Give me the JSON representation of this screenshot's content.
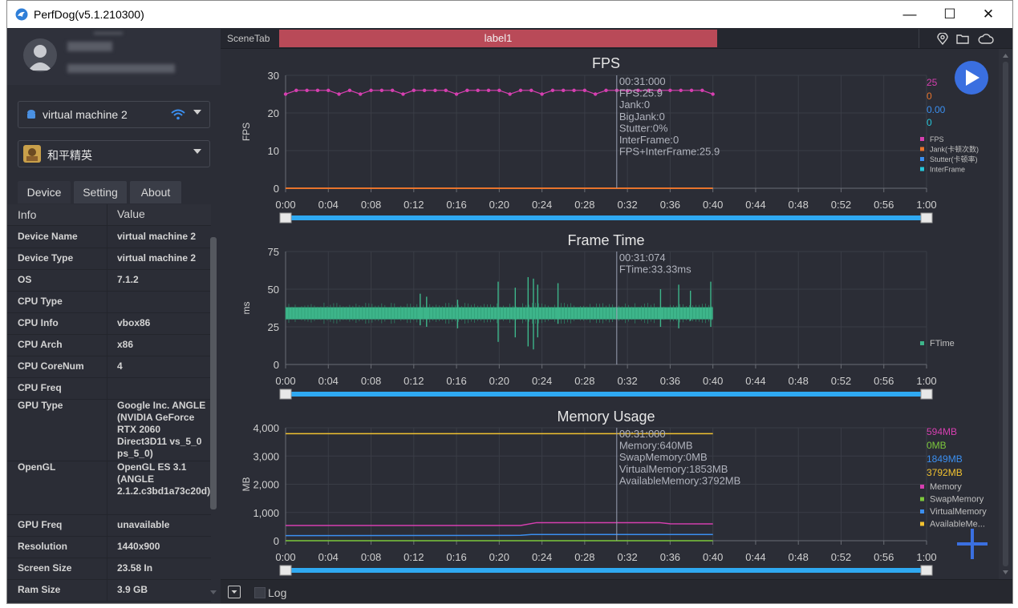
{
  "window": {
    "title": "PerfDog(v5.1.210300)",
    "minimize": "—",
    "maximize": "☐",
    "close": "✕"
  },
  "sidebar": {
    "device_select": "virtual machine 2",
    "app_select": "和平精英",
    "tabs": [
      {
        "label": "Device"
      },
      {
        "label": "Setting"
      },
      {
        "label": "About"
      }
    ],
    "table_header": {
      "key": "Info",
      "value": "Value"
    },
    "rows": [
      {
        "key": "Device Name",
        "value": "virtual machine 2"
      },
      {
        "key": "Device Type",
        "value": "virtual machine 2"
      },
      {
        "key": "OS",
        "value": "7.1.2"
      },
      {
        "key": "CPU Type",
        "value": ""
      },
      {
        "key": "CPU Info",
        "value": "vbox86"
      },
      {
        "key": "CPU Arch",
        "value": "x86"
      },
      {
        "key": "CPU CoreNum",
        "value": "4"
      },
      {
        "key": "CPU Freq",
        "value": ""
      },
      {
        "key": "GPU Type",
        "value": "Google Inc. ANGLE (NVIDIA GeForce RTX 2060 Direct3D11 vs_5_0 ps_5_0)"
      },
      {
        "key": "OpenGL",
        "value": "OpenGL ES 3.1 (ANGLE 2.1.2.c3bd1a73c20d)"
      },
      {
        "key": "GPU Freq",
        "value": "unavailable"
      },
      {
        "key": "Resolution",
        "value": "1440x900"
      },
      {
        "key": "Screen Size",
        "value": "23.58 In"
      },
      {
        "key": "Ram Size",
        "value": "3.9 GB"
      }
    ]
  },
  "scenebar": {
    "scene_tab": "SceneTab",
    "label": "label1"
  },
  "bottombar": {
    "log": "Log"
  },
  "colors": {
    "fps": "#d63fb0",
    "jank": "#e8742c",
    "stutter": "#3b8ff0",
    "interframe": "#26c6da",
    "ftime": "#3db58a",
    "memory": "#d63fb0",
    "swap": "#7cc83c",
    "virtual": "#3b8ff0",
    "available": "#f2c230",
    "accent_bar": "#2fa9f2",
    "play": "#3a6fe0"
  },
  "chart_data": [
    {
      "type": "line",
      "title": "FPS",
      "ylabel": "FPS",
      "xlabel": "",
      "x_ticks": [
        "0:00",
        "0:04",
        "0:08",
        "0:12",
        "0:16",
        "0:20",
        "0:24",
        "0:28",
        "0:32",
        "0:36",
        "0:40",
        "0:44",
        "0:48",
        "0:52",
        "0:56",
        "1:00"
      ],
      "xlim": [
        0,
        60
      ],
      "ylim": [
        0,
        30
      ],
      "y_ticks": [
        "0",
        "10",
        "20",
        "30"
      ],
      "cursor_x": 31,
      "series": [
        {
          "name": "FPS",
          "x": [
            0,
            1,
            2,
            3,
            4,
            5,
            6,
            7,
            8,
            9,
            10,
            11,
            12,
            13,
            14,
            15,
            16,
            17,
            18,
            19,
            20,
            21,
            22,
            23,
            24,
            25,
            26,
            27,
            28,
            29,
            30,
            31,
            32,
            33,
            34,
            35,
            36,
            37,
            38,
            39,
            40
          ],
          "values": [
            25,
            26,
            26,
            26,
            26,
            25,
            26,
            25,
            26,
            26,
            26,
            25,
            26,
            26,
            26,
            26,
            25,
            26,
            26,
            26,
            26,
            25,
            26,
            26,
            25,
            26,
            26,
            26,
            26,
            25,
            26,
            26,
            25.9,
            26,
            26,
            26,
            26,
            26,
            26,
            26,
            25
          ]
        },
        {
          "name": "Jank(卡顿次数)",
          "x": [
            0,
            40
          ],
          "values": [
            0,
            0
          ]
        },
        {
          "name": "Stutter(卡顿率)",
          "x": [
            0,
            40
          ],
          "values": [
            0,
            0
          ]
        },
        {
          "name": "InterFrame",
          "x": [
            0,
            40
          ],
          "values": [
            0,
            0
          ]
        }
      ],
      "legend_values": [
        "25",
        "0",
        "0.00",
        "0"
      ],
      "tooltip": [
        "00:31:000",
        "FPS:25.9",
        "Jank:0",
        "BigJank:0",
        "Stutter:0%",
        "InterFrame:0",
        "FPS+InterFrame:25.9"
      ]
    },
    {
      "type": "bar",
      "title": "Frame Time",
      "ylabel": "ms",
      "xlabel": "",
      "x_ticks": [
        "0:00",
        "0:04",
        "0:08",
        "0:12",
        "0:16",
        "0:20",
        "0:24",
        "0:28",
        "0:32",
        "0:36",
        "0:40",
        "0:44",
        "0:48",
        "0:52",
        "0:56",
        "1:00"
      ],
      "xlim": [
        0,
        60
      ],
      "ylim": [
        0,
        75
      ],
      "y_ticks": [
        "0",
        "25",
        "50",
        "75"
      ],
      "cursor_x": 31,
      "series": [
        {
          "name": "FTime",
          "band": [
            30,
            38
          ],
          "spikes": [
            {
              "x": 12.6,
              "low": 26,
              "high": 47
            },
            {
              "x": 13.2,
              "low": 25,
              "high": 45
            },
            {
              "x": 16.1,
              "low": 24,
              "high": 43
            },
            {
              "x": 19.9,
              "low": 15,
              "high": 55
            },
            {
              "x": 21.5,
              "low": 18,
              "high": 51
            },
            {
              "x": 22.7,
              "low": 12,
              "high": 58
            },
            {
              "x": 23.2,
              "low": 10,
              "high": 57
            },
            {
              "x": 23.6,
              "low": 18,
              "high": 53
            },
            {
              "x": 25.5,
              "low": 27,
              "high": 54
            },
            {
              "x": 35.1,
              "low": 25,
              "high": 50
            },
            {
              "x": 36.8,
              "low": 24,
              "high": 53
            },
            {
              "x": 37.9,
              "low": 29,
              "high": 49
            },
            {
              "x": 39.8,
              "low": 25,
              "high": 55
            }
          ]
        }
      ],
      "tooltip": [
        "00:31:074",
        "FTime:33.33ms"
      ]
    },
    {
      "type": "line",
      "title": "Memory Usage",
      "ylabel": "MB",
      "xlabel": "",
      "x_ticks": [
        "0:00",
        "0:04",
        "0:08",
        "0:12",
        "0:16",
        "0:20",
        "0:24",
        "0:28",
        "0:32",
        "0:36",
        "0:40",
        "0:44",
        "0:48",
        "0:52",
        "0:56",
        "1:00"
      ],
      "xlim": [
        0,
        60
      ],
      "ylim": [
        0,
        4000
      ],
      "y_ticks": [
        "0",
        "1,000",
        "2,000",
        "3,000",
        "4,000"
      ],
      "cursor_x": 31,
      "series": [
        {
          "name": "Memory",
          "x": [
            0,
            22,
            23.5,
            35,
            36,
            40
          ],
          "values": [
            540,
            540,
            640,
            640,
            600,
            594
          ]
        },
        {
          "name": "SwapMemory",
          "x": [
            0,
            40
          ],
          "values": [
            0,
            0
          ]
        },
        {
          "name": "VirtualMemory",
          "x": [
            0,
            22,
            23,
            40
          ],
          "values": [
            180,
            190,
            220,
            220
          ]
        },
        {
          "name": "AvailableMemory",
          "x": [
            0,
            40
          ],
          "values": [
            3792,
            3792
          ]
        }
      ],
      "legend_values": [
        "594MB",
        "0MB",
        "1849MB",
        "3792MB"
      ],
      "legend_names": [
        "Memory",
        "SwapMemory",
        "VirtualMemory",
        "AvailableMe..."
      ],
      "tooltip": [
        "00:31:000",
        "Memory:640MB",
        "SwapMemory:0MB",
        "VirtualMemory:1853MB",
        "AvailableMemory:3792MB"
      ]
    }
  ]
}
